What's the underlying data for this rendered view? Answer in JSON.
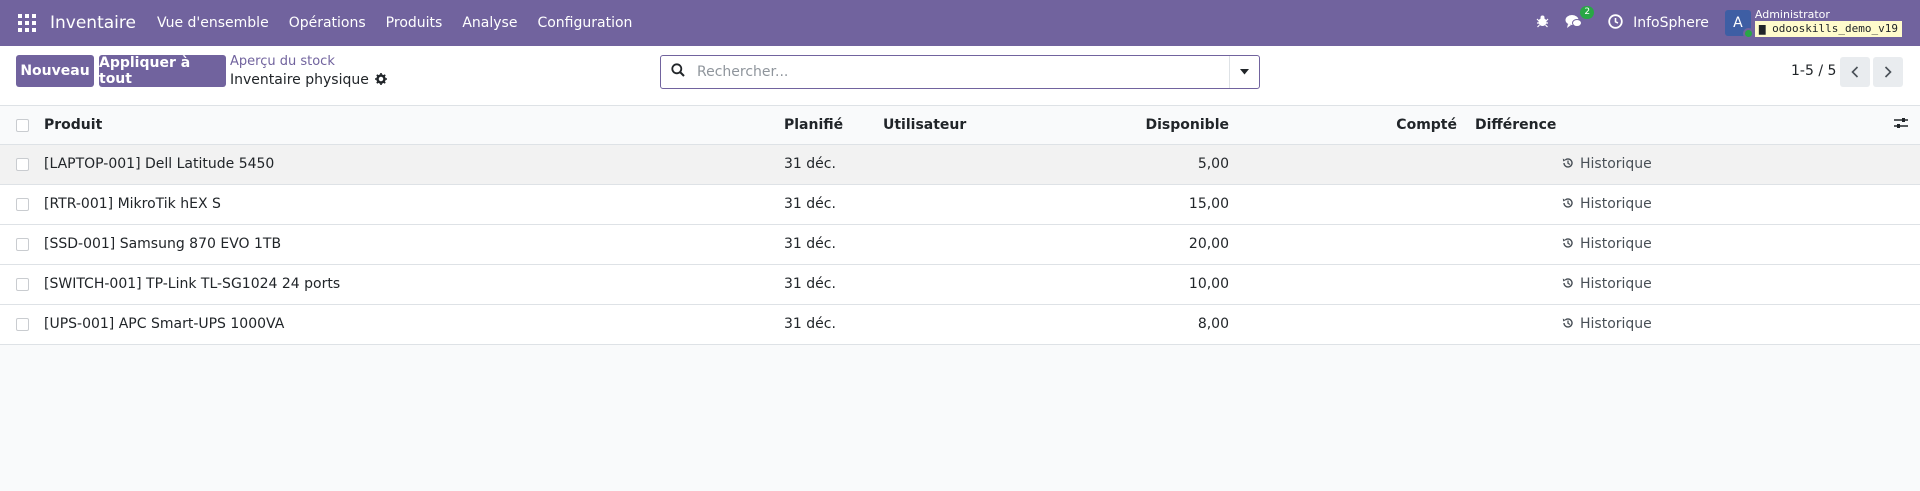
{
  "navbar": {
    "app_title": "Inventaire",
    "menu": [
      "Vue d'ensemble",
      "Opérations",
      "Produits",
      "Analyse",
      "Configuration"
    ],
    "chat_badge": "2",
    "company": "InfoSphere",
    "avatar_letter": "A",
    "user_name": "Administrator",
    "db_name": "odooskills_demo_v19",
    "color": "#71639e"
  },
  "control": {
    "new_label": "Nouveau",
    "apply_label": "Appliquer à tout",
    "breadcrumb": "Aperçu du stock",
    "title": "Inventaire physique",
    "search_placeholder": "Rechercher...",
    "pager": "1-5 / 5"
  },
  "table": {
    "headers": {
      "product": "Produit",
      "planned": "Planifié",
      "user": "Utilisateur",
      "available": "Disponible",
      "counted": "Compté",
      "difference": "Différence"
    },
    "history_label": "Historique",
    "rows": [
      {
        "product": "[LAPTOP-001] Dell Latitude 5450",
        "planned": "31 déc.",
        "available": "5,00"
      },
      {
        "product": "[RTR-001] MikroTik hEX S",
        "planned": "31 déc.",
        "available": "15,00"
      },
      {
        "product": "[SSD-001] Samsung 870 EVO 1TB",
        "planned": "31 déc.",
        "available": "20,00"
      },
      {
        "product": "[SWITCH-001] TP-Link TL-SG1024 24 ports",
        "planned": "31 déc.",
        "available": "10,00"
      },
      {
        "product": "[UPS-001] APC Smart-UPS 1000VA",
        "planned": "31 déc.",
        "available": "8,00"
      }
    ]
  }
}
